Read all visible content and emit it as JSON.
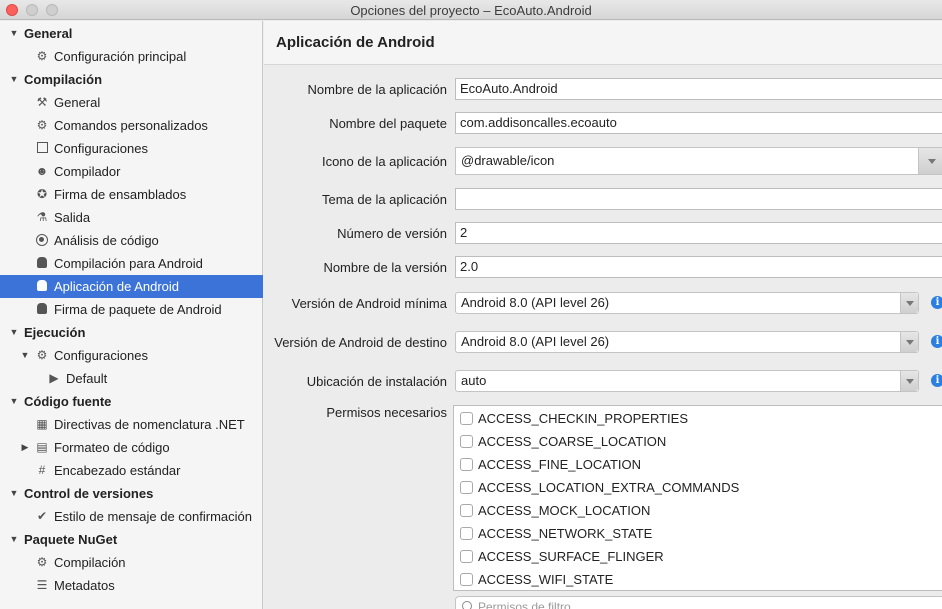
{
  "window": {
    "title": "Opciones del proyecto – EcoAuto.Android"
  },
  "sidebar": {
    "general": {
      "label": "General",
      "items": [
        "Configuración principal"
      ]
    },
    "compilacion": {
      "label": "Compilación",
      "items": [
        "General",
        "Comandos personalizados",
        "Configuraciones",
        "Compilador",
        "Firma de ensamblados",
        "Salida",
        "Análisis de código",
        "Compilación para Android",
        "Aplicación de Android",
        "Firma de paquete de Android"
      ]
    },
    "ejecucion": {
      "label": "Ejecución",
      "items": [
        "Configuraciones"
      ],
      "sub_items": [
        "Default"
      ]
    },
    "codigo_fuente": {
      "label": "Código fuente",
      "items": [
        "Directivas de nomenclatura .NET",
        "Formateo de código",
        "Encabezado estándar"
      ]
    },
    "control_versiones": {
      "label": "Control de versiones",
      "items": [
        "Estilo de mensaje de confirmación"
      ]
    },
    "nuget": {
      "label": "Paquete NuGet",
      "items": [
        "Compilación",
        "Metadatos"
      ]
    },
    "selected": "Aplicación de Android"
  },
  "main": {
    "title": "Aplicación de Android",
    "fields": {
      "app_name": {
        "label": "Nombre de la aplicación",
        "value": "EcoAuto.Android"
      },
      "package_name": {
        "label": "Nombre del paquete",
        "value": "com.addisoncalles.ecoauto"
      },
      "app_icon": {
        "label": "Icono de la aplicación",
        "value": "@drawable/icon"
      },
      "app_theme": {
        "label": "Tema de la aplicación",
        "value": ""
      },
      "version_number": {
        "label": "Número de versión",
        "value": "2"
      },
      "version_name": {
        "label": "Nombre de la versión",
        "value": "2.0"
      },
      "min_android": {
        "label": "Versión de Android mínima",
        "value": "Android 8.0 (API level 26)"
      },
      "target_android": {
        "label": "Versión de Android de destino",
        "value": "Android 8.0 (API level 26)"
      },
      "install_location": {
        "label": "Ubicación de instalación",
        "value": "auto"
      }
    },
    "permissions": {
      "label": "Permisos necesarios",
      "items": [
        "ACCESS_CHECKIN_PROPERTIES",
        "ACCESS_COARSE_LOCATION",
        "ACCESS_FINE_LOCATION",
        "ACCESS_LOCATION_EXTRA_COMMANDS",
        "ACCESS_MOCK_LOCATION",
        "ACCESS_NETWORK_STATE",
        "ACCESS_SURFACE_FLINGER",
        "ACCESS_WIFI_STATE"
      ],
      "filter_placeholder": "Permisos de filtro"
    },
    "info_icon": "i"
  },
  "colors": {
    "selection": "#3c73d8",
    "info": "#2a7fe0",
    "close": "#fc605c"
  }
}
